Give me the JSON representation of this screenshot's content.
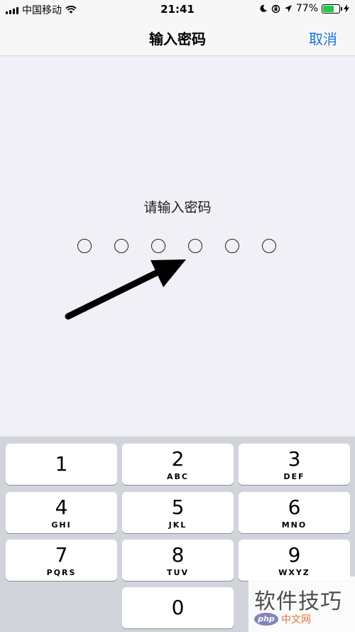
{
  "status_bar": {
    "carrier": "中国移动",
    "time": "21:41",
    "battery": "77%",
    "battery_level": 0.77
  },
  "nav": {
    "title": "输入密码",
    "cancel": "取消"
  },
  "passcode": {
    "prompt": "请输入密码",
    "digits_total": 6,
    "digits_entered": 0
  },
  "keypad": {
    "keys": [
      {
        "number": "1",
        "letters": ""
      },
      {
        "number": "2",
        "letters": "ABC"
      },
      {
        "number": "3",
        "letters": "DEF"
      },
      {
        "number": "4",
        "letters": "GHI"
      },
      {
        "number": "5",
        "letters": "JKL"
      },
      {
        "number": "6",
        "letters": "MNO"
      },
      {
        "number": "7",
        "letters": "PQRS"
      },
      {
        "number": "8",
        "letters": "TUV"
      },
      {
        "number": "9",
        "letters": "WXYZ"
      },
      {
        "number": "0",
        "letters": ""
      }
    ]
  },
  "watermark": {
    "text": "软件技巧",
    "logo": "php",
    "site": "中文网"
  },
  "colors": {
    "accent": "#1a74e0",
    "background": "#f0f0f6",
    "keypad_bg": "#d1d4da"
  }
}
